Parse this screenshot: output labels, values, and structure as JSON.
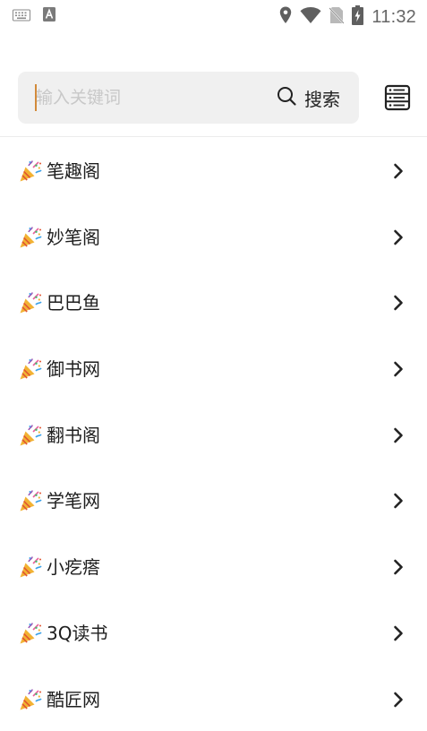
{
  "status_bar": {
    "time": "11:32"
  },
  "search": {
    "placeholder": "输入关键词",
    "button_label": "搜索"
  },
  "sources": [
    {
      "label": "笔趣阁"
    },
    {
      "label": "妙笔阁"
    },
    {
      "label": "巴巴鱼"
    },
    {
      "label": "御书网"
    },
    {
      "label": "翻书阁"
    },
    {
      "label": "学笔网"
    },
    {
      "label": "小疙瘩"
    },
    {
      "label": "3Q读书"
    },
    {
      "label": "酷匠网"
    }
  ],
  "icons": {
    "status_left": [
      "keyboard-icon",
      "a-notification-icon"
    ],
    "status_right": [
      "location-icon",
      "wifi-icon",
      "no-sim-icon",
      "battery-charging-icon"
    ],
    "search": "search-icon",
    "menu": "list-menu-icon",
    "item": "party-popper-icon",
    "item_trailing": "chevron-right-icon"
  },
  "colors": {
    "search_background": "#f0f0f0",
    "cursor": "#d28a3a",
    "placeholder": "#c8c8c8"
  }
}
